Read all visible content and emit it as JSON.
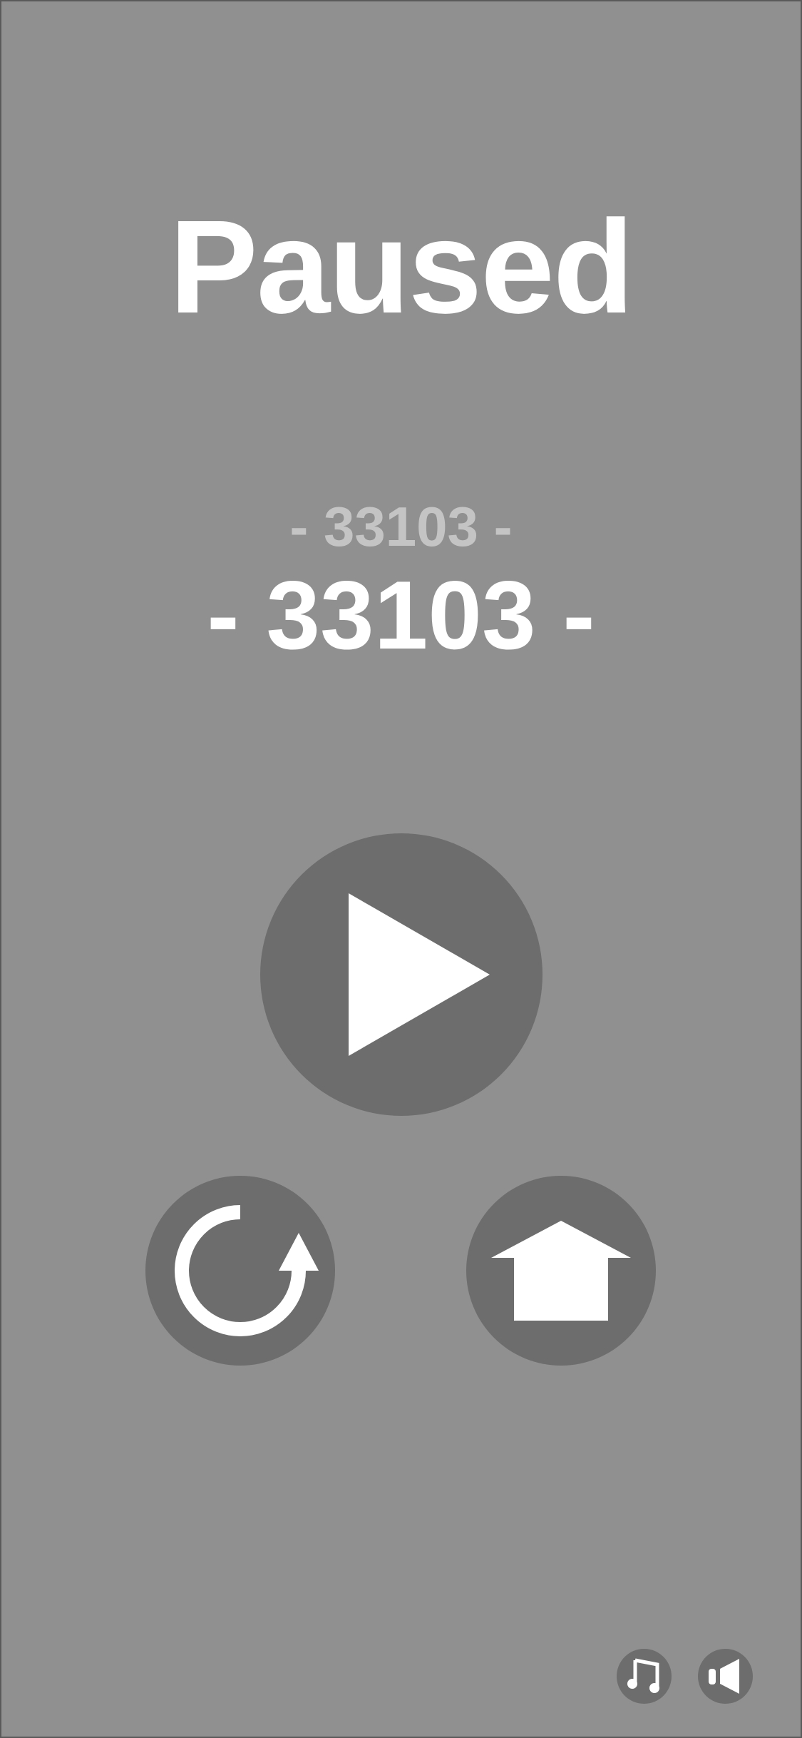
{
  "pause_screen": {
    "title": "Paused",
    "best_score_text": "- 33103 -",
    "current_score_text": "- 33103 -"
  },
  "buttons": {
    "resume": {
      "icon": "play-icon"
    },
    "restart": {
      "icon": "restart-icon"
    },
    "home": {
      "icon": "home-icon"
    },
    "music": {
      "icon": "music-note-icon"
    },
    "sound": {
      "icon": "speaker-icon"
    }
  },
  "colors": {
    "background": "#909090",
    "button_fill": "#6d6d6d",
    "icon_fill": "#ffffff",
    "best_score": "#c4c4c4",
    "text": "#ffffff"
  }
}
